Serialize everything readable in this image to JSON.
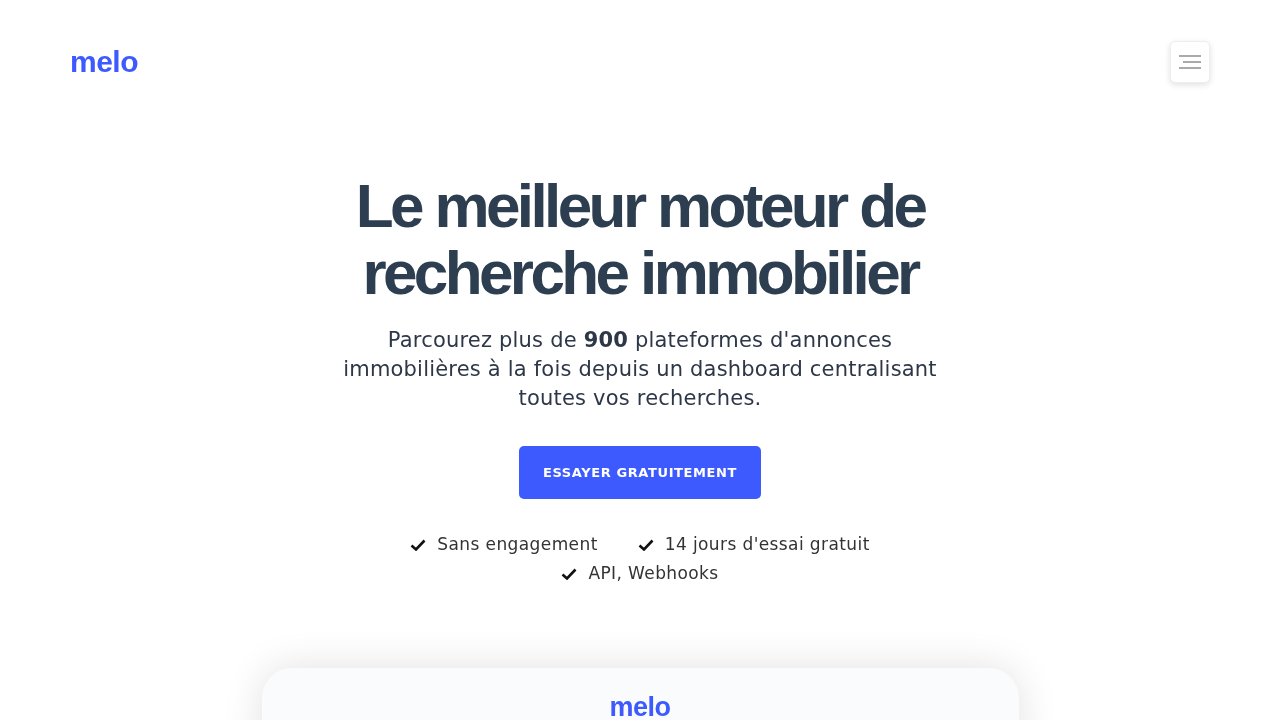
{
  "header": {
    "logo": "melo"
  },
  "hero": {
    "title": "Le meilleur moteur de recherche immobilier",
    "subtitle": "Parcourez plus de **900** plateformes d'annonces immobilières à la fois depuis un dashboard centralisant toutes vos recherches.",
    "cta": "ESSAYER GRATUITEMENT",
    "features": [
      "Sans engagement",
      "14 jours d'essai gratuit",
      "API, Webhooks"
    ]
  },
  "preview": {
    "logo": "melo"
  }
}
